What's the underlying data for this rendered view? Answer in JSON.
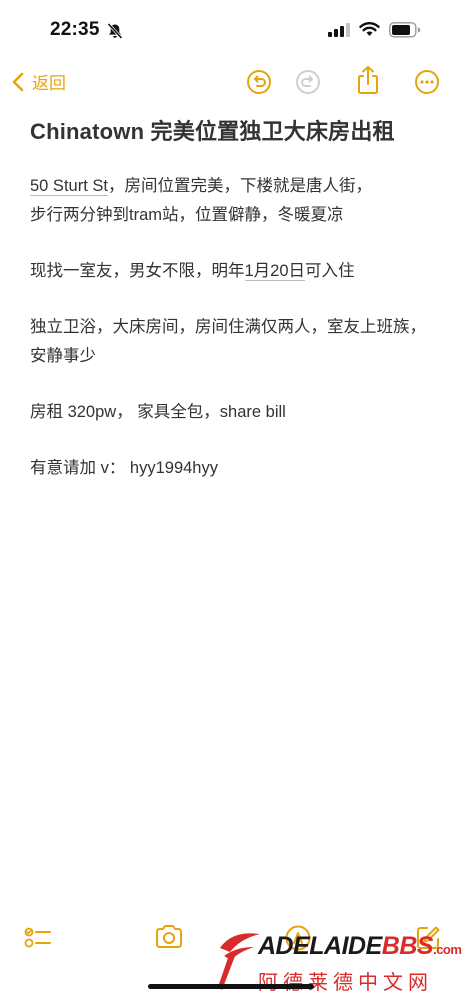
{
  "status_bar": {
    "time": "22:35",
    "icons": [
      "bell-slash-icon",
      "cellular-signal-icon",
      "wifi-icon",
      "battery-icon"
    ]
  },
  "nav": {
    "back_label": "返回",
    "icons": [
      "undo-icon",
      "redo-icon",
      "share-icon",
      "more-icon"
    ]
  },
  "note": {
    "title": "Chinatown 完美位置独卫大床房出租",
    "paragraphs": [
      {
        "address": "50 Sturt St",
        "line1_rest": "，房间位置完美，下楼就是唐人街，",
        "line2": "步行两分钟到tram站，位置僻静，冬暖夏凉"
      },
      {
        "before": "现找一室友，男女不限，明年",
        "date": "1月20日",
        "after": "可入住"
      },
      {
        "text": "独立卫浴，大床房间，房间住满仅两人，室友上班族，安静事少"
      },
      {
        "text": "房租 320pw， 家具全包，share bill"
      },
      {
        "text": "有意请加 v： hyy1994hyy"
      }
    ]
  },
  "toolbar": {
    "icons": [
      "checklist-icon",
      "camera-icon",
      "markup-icon",
      "compose-icon"
    ]
  },
  "watermark": {
    "brand_a": "ADELAIDE",
    "brand_b": "BBS",
    "brand_suffix": ".com",
    "chinese": "阿德莱德中文网"
  },
  "colors": {
    "accent": "#E5A50A",
    "text": "#333333",
    "watermark_red": "#d92b2b"
  }
}
